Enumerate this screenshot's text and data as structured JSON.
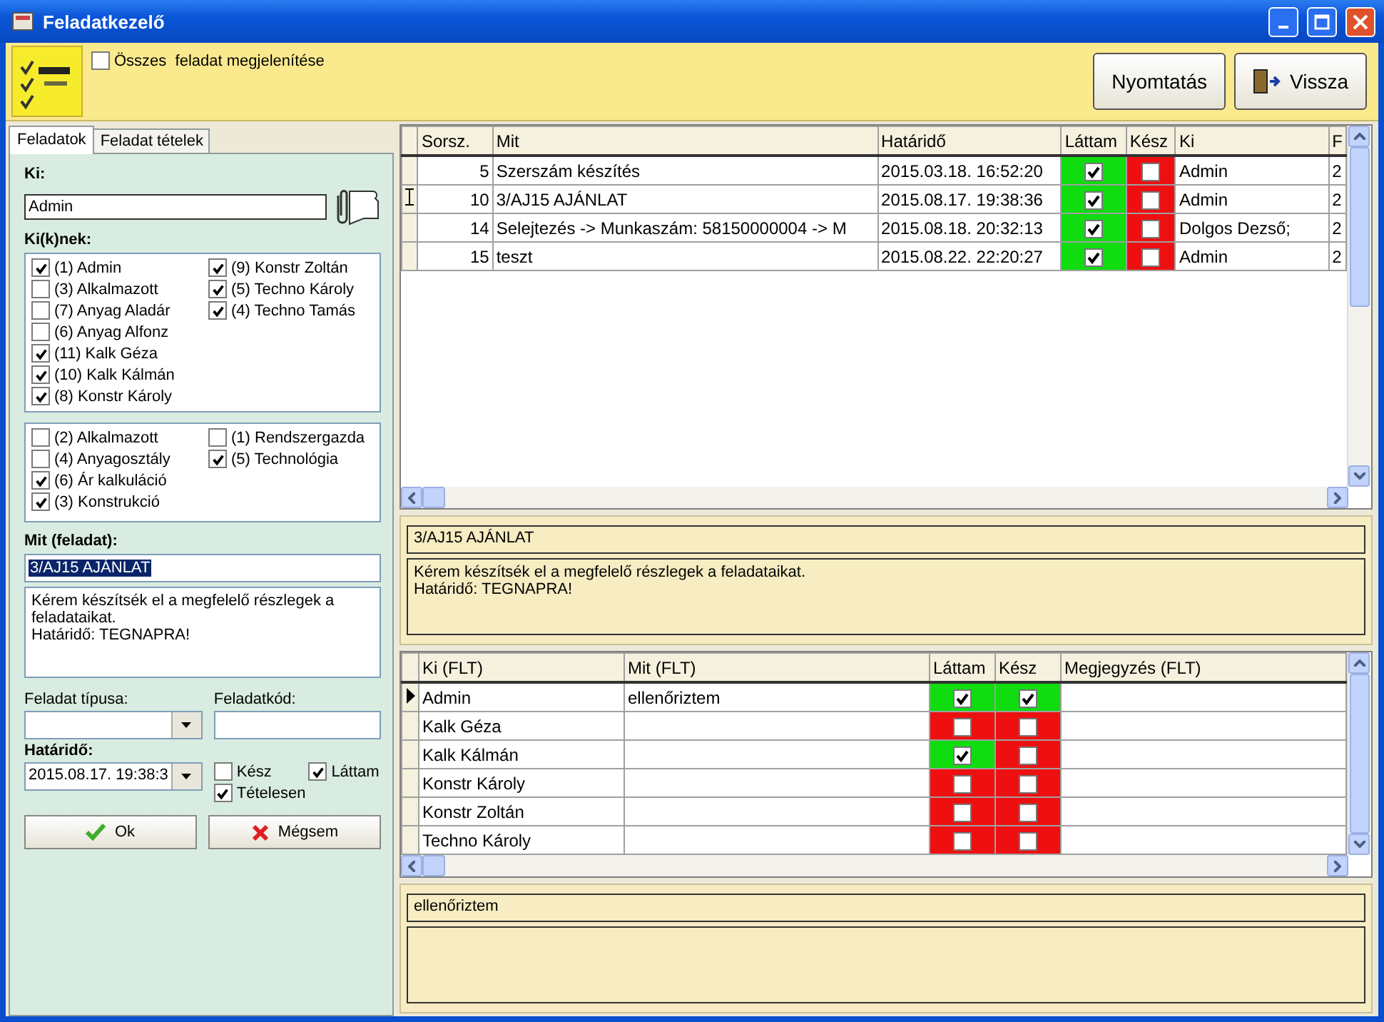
{
  "window": {
    "title": "Feladatkezelő"
  },
  "toolbar": {
    "show_all": {
      "label": "Összes  feladat megjelenítése",
      "checked": false
    },
    "buttons": [
      {
        "label": "Nyomtatás",
        "kind": "print"
      },
      {
        "label": "Vissza",
        "kind": "back"
      }
    ]
  },
  "tabs": [
    {
      "label": "Feladatok",
      "selected": true
    },
    {
      "label": "Feladat tételek",
      "selected": false
    }
  ],
  "form": {
    "ki_label": "Ki:",
    "ki_value": "Admin",
    "recipients_label": "Ki(k)nek:",
    "user_columns": [
      [
        {
          "label": "(1) Admin",
          "checked": true
        },
        {
          "label": "(3) Alkalmazott",
          "checked": false
        },
        {
          "label": "(7) Anyag Aladár",
          "checked": false
        },
        {
          "label": "(6) Anyag Alfonz",
          "checked": false
        },
        {
          "label": "(11) Kalk Géza",
          "checked": true
        },
        {
          "label": "(10) Kalk Kálmán",
          "checked": true
        },
        {
          "label": "(8) Konstr Károly",
          "checked": true
        }
      ],
      [
        {
          "label": "(9) Konstr Zoltán",
          "checked": true
        },
        {
          "label": "(5) Techno Károly",
          "checked": true
        },
        {
          "label": "(4) Techno Tamás",
          "checked": true
        }
      ]
    ],
    "group_columns": [
      [
        {
          "label": "(2) Alkalmazott",
          "checked": false
        },
        {
          "label": "(4) Anyagosztály",
          "checked": false
        },
        {
          "label": "(6) Ár kalkuláció",
          "checked": true
        },
        {
          "label": "(3) Konstrukció",
          "checked": true
        }
      ],
      [
        {
          "label": "(1) Rendszergazda",
          "checked": false
        },
        {
          "label": "(5) Technológia",
          "checked": true
        }
      ]
    ],
    "task_label": "Mit (feladat):",
    "task_value": "3/AJ15 AJÁNLAT",
    "description": "Kérem készítsék el a megfelelő részlegek a feladataikat.\nHatáridő: TEGNAPRA!",
    "type_label": "Feladat típusa:",
    "code_label": "Feladatkód:",
    "deadline_label": "Határidő:",
    "deadline_value": "2015.08.17. 19:38:3",
    "flags": [
      {
        "label": "Kész",
        "checked": false
      },
      {
        "label": "Láttam",
        "checked": true
      },
      {
        "label": "Tételesen",
        "checked": true
      }
    ],
    "buttons": [
      {
        "label": "Ok",
        "kind": "ok"
      },
      {
        "label": "Mégsem",
        "kind": "cancel"
      }
    ]
  },
  "tasks_grid": {
    "columns": [
      "Sorsz.",
      "Mit",
      "Határidő",
      "Láttam",
      "Kész",
      "Ki",
      "F"
    ],
    "rows": [
      {
        "editing": false,
        "number": "5",
        "what": "Szerszám készítés",
        "deadline": "2015.03.18. 16:52:20",
        "seen": true,
        "done": false,
        "who": "Admin",
        "column_7": "2"
      },
      {
        "editing": true,
        "number": "10",
        "what": "3/AJ15 AJÁNLAT",
        "deadline": "2015.08.17. 19:38:36",
        "seen": true,
        "done": false,
        "who": "Admin",
        "column_7": "2"
      },
      {
        "editing": false,
        "number": "14",
        "what": "Selejtezés -> Munkaszám: 58150000004 -> M",
        "deadline": "2015.08.18. 20:32:13",
        "seen": true,
        "done": false,
        "who": "Dolgos Dezső;",
        "column_7": "2"
      },
      {
        "editing": false,
        "number": "15",
        "what": "teszt",
        "deadline": "2015.08.22. 22:20:27",
        "seen": true,
        "done": false,
        "who": "Admin",
        "column_7": "2"
      }
    ]
  },
  "detail": {
    "title": "3/AJ15 AJÁNLAT",
    "text": "Kérem készítsék el a megfelelő részlegek a feladataikat.\nHatáridő: TEGNAPRA!"
  },
  "items_grid": {
    "columns": [
      "Ki (FLT)",
      "Mit (FLT)",
      "Láttam",
      "Kész",
      "Megjegyzés (FLT)"
    ],
    "rows": [
      {
        "current": true,
        "who": "Admin",
        "what": "ellenőriztem",
        "seen": true,
        "done": true
      },
      {
        "current": false,
        "who": "Kalk Géza",
        "seen": false,
        "done": false
      },
      {
        "current": false,
        "who": "Kalk Kálmán",
        "seen": true,
        "done": false
      },
      {
        "current": false,
        "who": "Konstr Károly",
        "seen": false,
        "done": false
      },
      {
        "current": false,
        "who": "Konstr Zoltán",
        "seen": false,
        "done": false
      },
      {
        "current": false,
        "who": "Techno Károly",
        "seen": false,
        "done": false
      }
    ]
  },
  "item_detail": {
    "title": "ellenőriztem"
  }
}
